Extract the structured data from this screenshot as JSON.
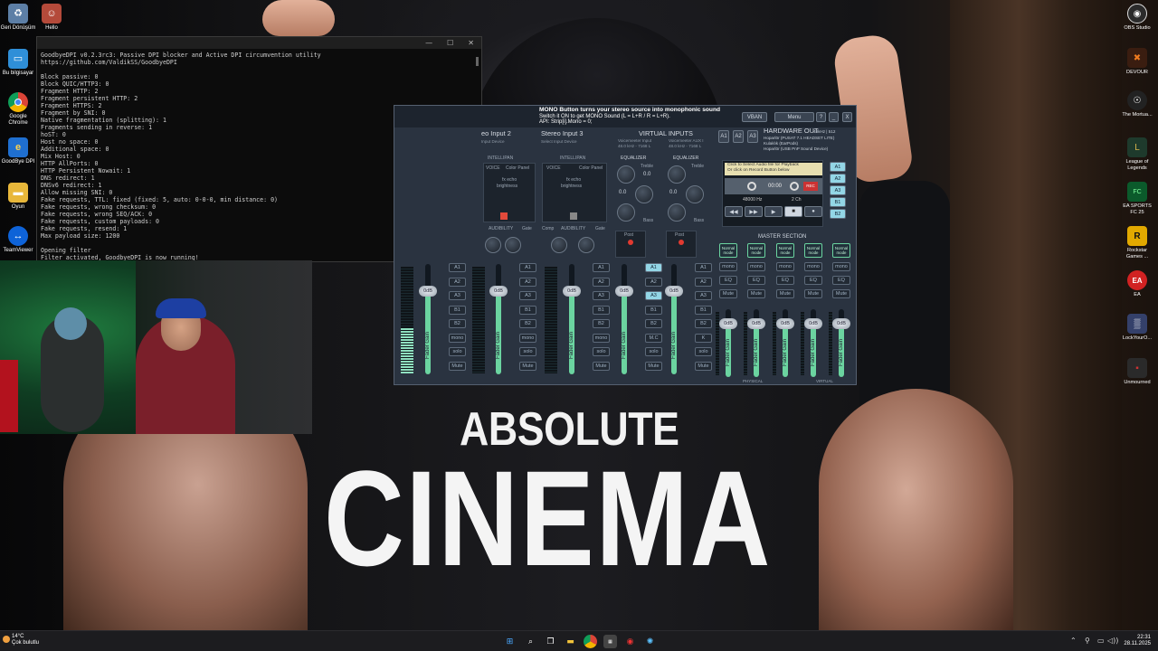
{
  "wallpaper": {
    "title_line1": "ABSOLUTE",
    "title_line2": "CINEMA"
  },
  "desktop_icons_left": [
    {
      "label": "Geri Dönüşüm",
      "icon": "recycle-bin-icon"
    },
    {
      "label": "Hello",
      "icon": "hello-shortcut-icon"
    },
    {
      "label": "Bu bilgisayar",
      "icon": "this-pc-icon"
    },
    {
      "label": "Google Chrome",
      "icon": "chrome-icon"
    },
    {
      "label": "GoodBye DPI",
      "icon": "ie-icon"
    },
    {
      "label": "Oyun",
      "icon": "folder-icon"
    },
    {
      "label": "TeamViewer",
      "icon": "teamviewer-icon"
    }
  ],
  "desktop_icons_right": [
    {
      "label": "OBS Studio",
      "icon": "obs-icon",
      "color": "#2b2b2b"
    },
    {
      "label": "DEVOUR",
      "icon": "devour-icon",
      "color": "#3a1d10"
    },
    {
      "label": "The Mortua...",
      "icon": "mortuary-icon",
      "color": "#222"
    },
    {
      "label": "League of Legends",
      "icon": "lol-icon",
      "color": "#1e3a2c"
    },
    {
      "label": "EA SPORTS FC 25",
      "icon": "fc25-icon",
      "color": "#0b5a2b"
    },
    {
      "label": "Rockstar Games ...",
      "icon": "rockstar-icon",
      "color": "#e2a900"
    },
    {
      "label": "EA",
      "icon": "ea-icon",
      "color": "#d12222"
    },
    {
      "label": "LockYourO...",
      "icon": "lock-icon",
      "color": "#34406a"
    },
    {
      "label": "Unmourned",
      "icon": "unmourned-icon",
      "color": "#2a2a2a"
    }
  ],
  "terminal": {
    "lines": [
      "GoodbyeDPI v0.2.3rc3: Passive DPI blocker and Active DPI circumvention utility",
      "https://github.com/ValdikSS/GoodbyeDPI",
      "",
      "Block passive: 0",
      "Block QUIC/HTTP3: 0",
      "Fragment HTTP: 2",
      "Fragment persistent HTTP: 2",
      "Fragment HTTPS: 2",
      "Fragment by SNI: 0",
      "Native fragmentation (splitting): 1",
      "Fragments sending in reverse: 1",
      "hoST: 0",
      "Host no space: 0",
      "Additional space: 0",
      "Mix Host: 0",
      "HTTP AllPorts: 0",
      "HTTP Persistent Nowait: 1",
      "DNS redirect: 1",
      "DNSv6 redirect: 1",
      "Allow missing SNI: 0",
      "Fake requests, TTL: fixed (fixed: 5, auto: 0-0-0, min distance: 0)",
      "Fake requests, wrong checksum: 0",
      "Fake requests, wrong SEQ/ACK: 0",
      "Fake requests, custom payloads: 0",
      "Fake requests, resend: 1",
      "Max payload size: 1200",
      "",
      "Opening filter",
      "Filter activated, GoodbyeDPI is now running!"
    ],
    "controls": {
      "minimize": "—",
      "maximize": "☐",
      "close": "✕"
    }
  },
  "voicemeeter": {
    "tooltip_title": "MONO Button turns your stereo source into monophonic sound",
    "tooltip_line2": "Switch it ON to get MONO Sound (L = L+R / R = L+R).",
    "tooltip_line3": "API: Strip[i].Mono = 0;",
    "vban": "VBAN",
    "menu": "Menu",
    "help": "?",
    "minimize": "_",
    "close": "X",
    "strip_headers": [
      "eo Input 2",
      "Stereo Input 3"
    ],
    "strip_sub": [
      "Input Device",
      "Select Input Device"
    ],
    "virtual_inputs": "VIRTUAL INPUTS",
    "virtual_sub1": "Voicemeeter Input",
    "virtual_sub1b": "48.0 kHz - 7168 L",
    "virtual_sub2": "Voicemeeter AUX I",
    "virtual_sub2b": "48.0 kHz - 7168 L",
    "bus_labels": [
      "A1",
      "A2",
      "A3"
    ],
    "hardware_out": "HARDWARE OUT",
    "hardware_sub": "48kHz | 512",
    "devices": [
      "Hoparlör (PUSAT 7.1 HEADSET LITE)",
      "Kulaklık (EarPods)",
      "Hoparlör (USB PnP Sound Device)"
    ],
    "intellipan": "INTELLIPAN",
    "voice": "VOICE",
    "color_panel": "Color Panel",
    "fx_echo": "fx echo",
    "brightness": "brightness",
    "equalizer": "EQUALIZER",
    "treble": "Treble",
    "bass": "Bass",
    "eq_values": [
      "0.0",
      "0.0",
      "0.0",
      "0.0"
    ],
    "audibility": "AUDIBILITY",
    "comp": "Comp",
    "gate": "Gate",
    "post": "Post",
    "fader_gain": "Fader Gain",
    "fader_value": "0dB",
    "strip_buttons": [
      "A1",
      "A2",
      "A3",
      "B1",
      "B2",
      "mono",
      "solo",
      "Mute"
    ],
    "virtual_mc": "M.C",
    "virtual_k": "K",
    "recorder": {
      "line1": "Click to Select Audio file for Playback",
      "line2": "Or click on Record Button below",
      "time": "00:00",
      "rate": "48000 Hz",
      "channels": "2 Ch",
      "rec": "REC"
    },
    "rec_bus": [
      "A1",
      "A2",
      "A3",
      "B1",
      "B2"
    ],
    "master_section": "MASTER SECTION",
    "master_buttons": [
      "Normal mode",
      "mono",
      "EQ",
      "Mute"
    ],
    "master_bus": [
      "A1",
      "A2",
      "A3",
      "B1",
      "B2"
    ],
    "physical": "PHYSICAL",
    "virtual": "VIRTUAL"
  },
  "taskbar": {
    "weather_temp": "14°C",
    "weather_desc": "Çok bulutlu",
    "time": "22:31",
    "date": "28.11.2025"
  }
}
